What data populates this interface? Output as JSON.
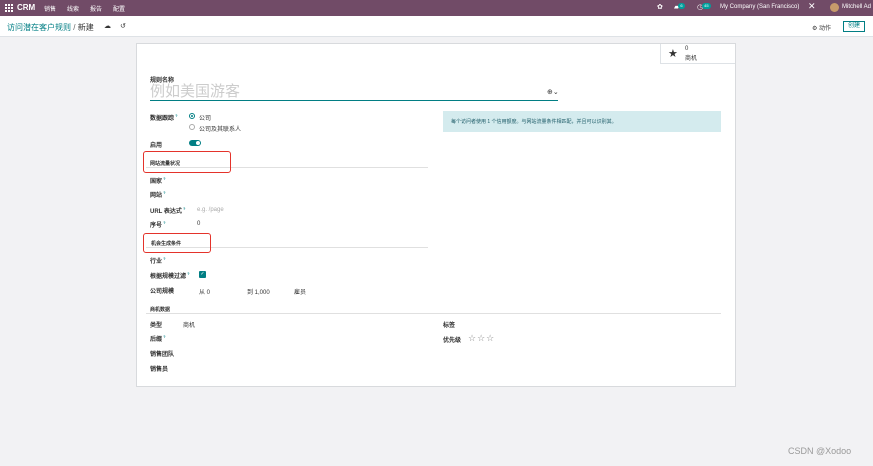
{
  "topbar": {
    "app_name": "CRM",
    "menu": [
      "销售",
      "线索",
      "报告",
      "配置"
    ],
    "chat_count": "6",
    "activity_count": "45",
    "company": "My Company (San Francisco)",
    "user": "Mitchell Ad"
  },
  "control_panel": {
    "breadcrumb_parent": "访问潜在客户规则",
    "breadcrumb_sep": "/",
    "breadcrumb_current": "新建",
    "action_label": "⚙ 动作",
    "create_label": "创建"
  },
  "buttonbox": {
    "count": "0",
    "label": "商机"
  },
  "form": {
    "name_label": "规则名称",
    "name_placeholder": "例如美国游客",
    "data_tracking_label": "数据跟踪",
    "radio_company": "公司",
    "radio_company_contacts": "公司及其联系人",
    "active_label": "启用",
    "info_text": "每个访问者使用 1 个信用额度。与网站流量条件相匹配，并且可以识别其。",
    "section_traffic": "网站流量状况",
    "country_label": "国家",
    "website_label": "网站",
    "url_label": "URL 表达式",
    "url_placeholder": "e.g. /page",
    "sequence_label": "序号",
    "sequence_value": "0",
    "section_conditions": "机会生成条件",
    "industry_label": "行业",
    "size_filter_label": "根据规模过滤",
    "size_label": "公司规模",
    "size_from": "从 0",
    "size_to": "到 1,000",
    "size_unit": "雇员",
    "section_opportunity": "商机数据",
    "type_label": "类型",
    "type_value": "商机",
    "suffix_label": "后缀",
    "team_label": "销售团队",
    "salesperson_label": "销售员",
    "tags_label": "标签",
    "priority_label": "优先级",
    "priority_stars": "☆☆☆"
  },
  "watermark": "CSDN @Xodoo",
  "colors": {
    "brand": "#714b67",
    "accent": "#017e84",
    "highlight": "#e4332b",
    "info_bg": "#d4ebee"
  }
}
